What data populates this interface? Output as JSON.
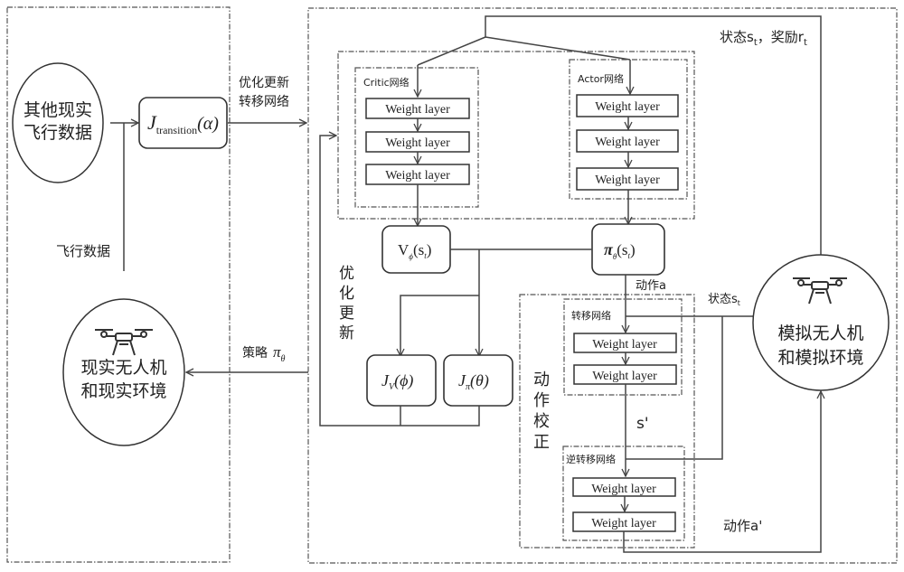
{
  "left_panel": {
    "other_data_node": {
      "line1": "其他现实",
      "line2": "飞行数据"
    },
    "transition_loss": {
      "symbol": "J",
      "subscript": "transition",
      "arg": "(α)"
    },
    "flight_data_label": "飞行数据",
    "real_drone_node": {
      "icon": "drone-icon",
      "line1": "现实无人机",
      "line2": "和现实环境"
    }
  },
  "connectors": {
    "update_transition_label": {
      "line1": "优化更新",
      "line2": "转移网络"
    },
    "policy_label": {
      "text": "策略",
      "symbol": "π",
      "subscript": "θ"
    }
  },
  "right_panel": {
    "state_reward_label": {
      "state": "状态s",
      "state_sub": "t",
      "sep": "，",
      "reward": "奖励r",
      "reward_sub": "t"
    },
    "critic_network": {
      "title": "Critic网络",
      "layers": [
        "Weight layer",
        "Weight layer",
        "Weight layer"
      ]
    },
    "actor_network": {
      "title": "Actor网络",
      "layers": [
        "Weight layer",
        "Weight layer",
        "Weight layer"
      ]
    },
    "value_node": {
      "symbol": "V",
      "subscript": "ϕ",
      "arg": "(s",
      "arg_sub": "t",
      "close": ")"
    },
    "policy_node": {
      "symbol": "π",
      "subscript": "θ",
      "arg": "(s",
      "arg_sub": "t",
      "close": ")"
    },
    "optimize_label": [
      "优",
      "化",
      "更",
      "新"
    ],
    "critic_loss": {
      "symbol": "J",
      "subscript": "V",
      "arg": "(ϕ)"
    },
    "actor_loss": {
      "symbol": "J",
      "subscript": "π",
      "arg": "(θ)"
    },
    "action_label": "动作a",
    "state_label": {
      "text": "状态s",
      "sub": "t"
    },
    "action_correction_label": [
      "动",
      "作",
      "校",
      "正"
    ],
    "transition_network": {
      "title": "转移网络",
      "layers": [
        "Weight layer",
        "Weight layer"
      ]
    },
    "next_state_label": "s'",
    "inverse_transition_network": {
      "title": "逆转移网络",
      "layers": [
        "Weight layer",
        "Weight layer"
      ]
    },
    "corrected_action_label": "动作a'",
    "sim_drone_node": {
      "icon": "drone-icon",
      "line1": "模拟无人机",
      "line2": "和模拟环境"
    }
  }
}
